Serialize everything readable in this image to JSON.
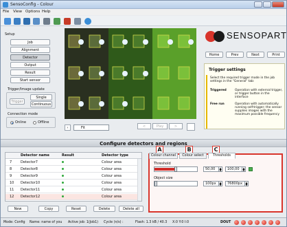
{
  "window": {
    "title": "SensoConfig - Colour"
  },
  "menu": [
    "File",
    "View",
    "Options",
    "Help"
  ],
  "toolbar": {
    "icons": [
      "new-icon",
      "open-icon",
      "save-icon",
      "export-icon",
      "camera-icon",
      "sensor-icon",
      "record-icon",
      "settings-icon",
      "help-icon"
    ]
  },
  "setup": {
    "label": "Setup",
    "buttons": [
      "Job",
      "Alignment",
      "Detector",
      "Output",
      "Result",
      "Start sensor"
    ],
    "active": "Detector"
  },
  "trigger": {
    "label": "Trigger/Image update",
    "trigger_btn": "Trigger",
    "single": "Single",
    "continuous": "Continuous"
  },
  "connection": {
    "label": "Connection mode",
    "online": "Online",
    "offline": "Offline",
    "selected": "Online"
  },
  "view": {
    "zoom": "Fit",
    "play": "Play"
  },
  "brand": {
    "name": "SENSOPART"
  },
  "right_buttons": [
    "Home",
    "Prev",
    "Next",
    "Print"
  ],
  "help": {
    "title": "Trigger settings",
    "intro": "Select the required trigger mode in the job settings in the \"General\" tab:",
    "rows": [
      {
        "term": "Triggered",
        "desc": "Operation with external trigger, or trigger button in the interface"
      },
      {
        "term": "Free run",
        "desc": "Operation with automatically running self-trigger; the sensor supplies images with the maximum possible frequency"
      }
    ]
  },
  "section": {
    "title": "Configure detectors and regions"
  },
  "table": {
    "headers": [
      "Detector name",
      "Result",
      "Detector type"
    ],
    "rows": [
      {
        "n": "7",
        "name": "Detector7",
        "type": "Colour area"
      },
      {
        "n": "8",
        "name": "Detector8",
        "type": "Colour area"
      },
      {
        "n": "9",
        "name": "Detector9",
        "type": "Colour area"
      },
      {
        "n": "10",
        "name": "Detector10",
        "type": "Colour area"
      },
      {
        "n": "11",
        "name": "Detector11",
        "type": "Colour area"
      },
      {
        "n": "12",
        "name": "Detector12",
        "type": "Colour area"
      }
    ]
  },
  "table_buttons": [
    "New",
    "Copy",
    "Reset",
    "Delete",
    "Delete all"
  ],
  "tabs": [
    "Colour channel",
    "Colour select",
    "Thresholds"
  ],
  "markers": [
    "A",
    "B",
    "C"
  ],
  "params": {
    "threshold_label": "Threshold",
    "threshold_value": "50,00",
    "threshold_max": "100,00",
    "threshold_fill": 0.5,
    "objsize_label": "Object size",
    "objsize_min": "100px",
    "objsize_max": "76800px",
    "objsize_fill": 0.02
  },
  "status": {
    "mode": "Mode: Config",
    "name": "Name: name of you",
    "active_job": "Active job: 1(Job1)",
    "cycle": "Cycle (n/s) :",
    "flash": "Flash: 1.3 kB / 40.3",
    "xy": "X:0 Y:0 I:0",
    "dout": "DOUT"
  }
}
